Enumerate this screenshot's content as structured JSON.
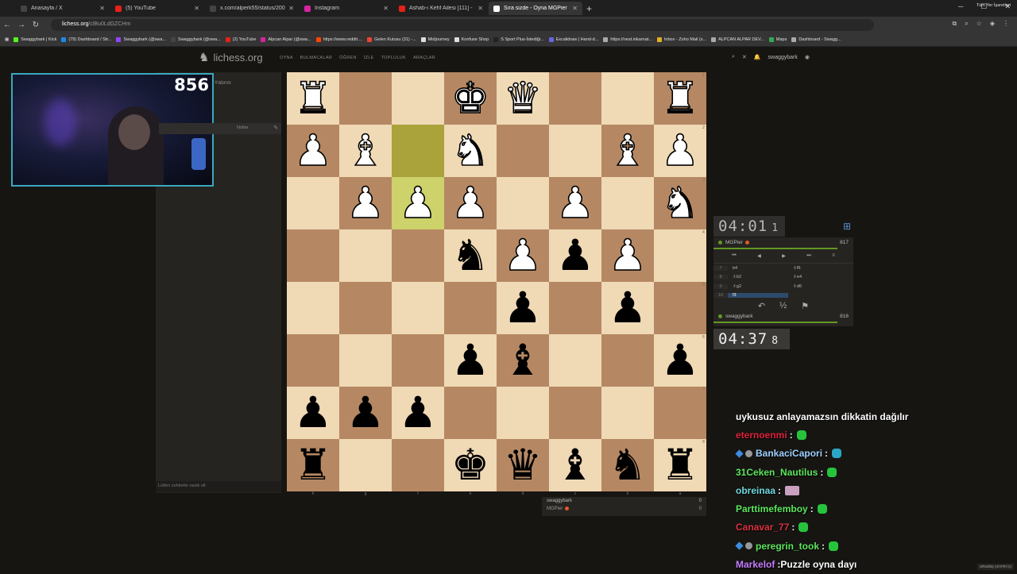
{
  "browser": {
    "tabs": [
      {
        "label": "Anasayfa / X",
        "color": "#444444"
      },
      {
        "label": "(5) YouTube",
        "color": "#e62117"
      },
      {
        "label": "x.com/alperk55/status/200989...",
        "color": "#444444"
      },
      {
        "label": "Instagram",
        "color": "#d6249f"
      },
      {
        "label": "Ashab-ı Kehf Ailesi [111] - bayi...",
        "color": "#e62117"
      },
      {
        "label": "Sıra sizde - Oyna MGPier • lich...",
        "color": "#ffffff"
      }
    ],
    "url_host": "lichess.org",
    "url_path": "/clBu0LdGZCHm",
    "bookmarks": [
      {
        "label": "Swaggybark | Kick",
        "color": "#53fc18"
      },
      {
        "label": "(79) Dashboard / Str...",
        "color": "#1e88e5"
      },
      {
        "label": "Swaggybark (@swa...",
        "color": "#9146ff"
      },
      {
        "label": "Swaggybark (@swa...",
        "color": "#444444"
      },
      {
        "label": "(2) YouTube",
        "color": "#e62117"
      },
      {
        "label": "Alpcan Alpar (@swa...",
        "color": "#d6249f"
      },
      {
        "label": "https://www.reddit....",
        "color": "#ff4500"
      },
      {
        "label": "Gelen Kutusu (31) -...",
        "color": "#ea4335"
      },
      {
        "label": "Midjourney",
        "color": "#dddddd"
      },
      {
        "label": "Konfuse Shop",
        "color": "#dddddd"
      },
      {
        "label": "S Sport Plus-İstediği...",
        "color": "#222222"
      },
      {
        "label": "Excalidraw | Hand-d...",
        "color": "#6965db"
      },
      {
        "label": "https://nest.inkarnat...",
        "color": "#aaaaaa"
      },
      {
        "label": "Inbox - Zoho Mail (s...",
        "color": "#e0b020"
      },
      {
        "label": "ALPCAN ALPAR DEV...",
        "color": "#aaaaaa"
      },
      {
        "label": "Maps",
        "color": "#34a853"
      },
      {
        "label": "Dashboard - Swagg...",
        "color": "#aaaaaa"
      }
    ],
    "all_bookmarks": "Tüm Yer İşaretleri"
  },
  "site": {
    "logo": "lichess.org",
    "nav": [
      "OYNA",
      "BULMACALAR",
      "ÖĞREN",
      "İZLE",
      "TOPLULUK",
      "ARAÇLAR"
    ],
    "username": "swaggybark"
  },
  "left": {
    "webcam_score": "856",
    "game_type": "Yıldırım",
    "notes_label": "Notlar",
    "chat_placeholder": "Lütfen sohbette nazik olt"
  },
  "board": {
    "squares": [
      "R",
      "",
      "",
      "K",
      "Q",
      "",
      "",
      "R",
      "P",
      "B",
      "",
      "N",
      "",
      "",
      "B",
      "P",
      "",
      "P",
      "P",
      "P",
      "",
      "P",
      "",
      "N",
      "",
      "",
      "",
      "n",
      "P",
      "p",
      "P",
      "",
      "",
      "",
      "",
      "",
      "p",
      "",
      "p",
      "",
      "",
      "",
      "",
      "p",
      "b",
      "",
      "",
      "p",
      "p",
      "p",
      "p",
      "",
      "",
      "",
      "",
      "",
      "r",
      "",
      "",
      "k",
      "q",
      "b",
      "n",
      "r"
    ],
    "files": [
      "h",
      "g",
      "f",
      "e",
      "d",
      "c",
      "b",
      "a"
    ],
    "ranks": [
      "1",
      "2",
      "3",
      "4",
      "5",
      "6",
      "7",
      "8"
    ],
    "highlight": [
      10,
      18
    ]
  },
  "material": {
    "white_name": "swaggybark",
    "white_score": "0",
    "black_name": "MGPier",
    "black_score": "0"
  },
  "clocks": {
    "opponent": {
      "main": "04:01",
      "tenths": "1"
    },
    "me": {
      "main": "04:37",
      "tenths": "8"
    }
  },
  "players": {
    "opponent": {
      "name": "MGPier",
      "rating": "817"
    },
    "me": {
      "name": "swaggybark",
      "rating": "816"
    }
  },
  "controls": [
    "⏮",
    "◀",
    "▶",
    "⏭",
    "≡"
  ],
  "moves": [
    {
      "n": "7",
      "w": "b4",
      "b": "♗f6"
    },
    {
      "n": "8",
      "w": "♗b2",
      "b": "♗e4"
    },
    {
      "n": "9",
      "w": "♗g2",
      "b": "♗d6"
    },
    {
      "n": "10",
      "w": "f3",
      "b": ""
    }
  ],
  "actions": [
    "↶",
    "½",
    "⚑"
  ],
  "chat": [
    {
      "nick": "",
      "color": "#ffffff",
      "msg": "uykusuz anlayamazsın dikkatin dağılır",
      "emote": "",
      "badge": false
    },
    {
      "nick": "eternoenmi",
      "color": "#e0213a",
      "msg": "",
      "emote": "g",
      "badge": false
    },
    {
      "nick": "BankaciCapori",
      "color": "#9ed0ff",
      "msg": "",
      "emote": "b",
      "badge": true
    },
    {
      "nick": "31Ceken_Nautilus",
      "color": "#5ce65c",
      "msg": "",
      "emote": "g",
      "badge": false
    },
    {
      "nick": "obreinaa",
      "color": "#70d8e0",
      "msg": "",
      "emote": "p",
      "badge": false
    },
    {
      "nick": "Parttimefemboy",
      "color": "#5ce65c",
      "msg": "",
      "emote": "g",
      "badge": false
    },
    {
      "nick": "Canavar_77",
      "color": "#d9323f",
      "msg": "",
      "emote": "g",
      "badge": false
    },
    {
      "nick": "peregrin_took",
      "color": "#5ce65c",
      "msg": "",
      "emote": "g",
      "badge": true
    },
    {
      "nick": "Markelof",
      "color": "#c77dff",
      "msg": "Puzzle oyna dayı",
      "emote": "",
      "badge": false
    }
  ],
  "corner": "arkadaş çevrim içi"
}
